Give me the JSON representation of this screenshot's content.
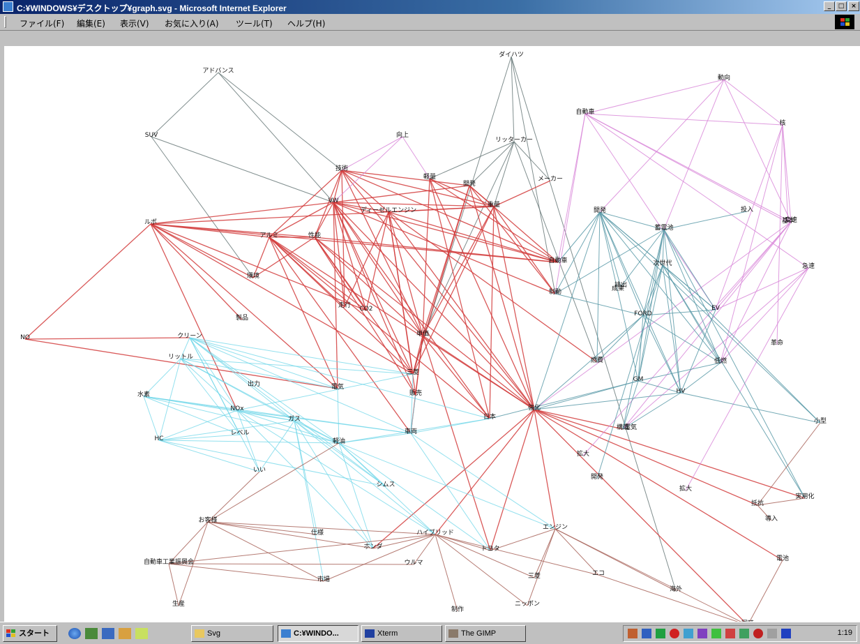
{
  "window": {
    "title": "C:¥WINDOWS¥デスクトップ¥graph.svg - Microsoft Internet Explorer",
    "minimize": "_",
    "maximize": "□",
    "close": "×"
  },
  "menu": [
    "ファイル(F)",
    "編集(E)",
    "表示(V)",
    "お気に入り(A)",
    "ツール(T)",
    "ヘルプ(H)"
  ],
  "graph": {
    "nodes": [
      {
        "id": "daihatsu",
        "label": "ダイハツ"
      },
      {
        "id": "advance",
        "label": "アドバンス"
      },
      {
        "id": "suv",
        "label": "SUV"
      },
      {
        "id": "kouzyou",
        "label": "向上"
      },
      {
        "id": "kakyou",
        "label": "自動車"
      },
      {
        "id": "maker",
        "label": "メーカー"
      },
      {
        "id": "hybrid_top",
        "label": "リッターカー"
      },
      {
        "id": "gijutsu",
        "label": "技術"
      },
      {
        "id": "vw",
        "label": "VW"
      },
      {
        "id": "diesel",
        "label": "ディーゼルエンジン"
      },
      {
        "id": "lupo",
        "label": "ルポ"
      },
      {
        "id": "alumi",
        "label": "アルミ"
      },
      {
        "id": "seinou",
        "label": "性能"
      },
      {
        "id": "keihou",
        "label": "軽量"
      },
      {
        "id": "kaihatsu",
        "label": "開発"
      },
      {
        "id": "juuryou",
        "label": "重量"
      },
      {
        "id": "doukou",
        "label": "動向"
      },
      {
        "id": "co2",
        "label": "CO2"
      },
      {
        "id": "kouden",
        "label": "走行"
      },
      {
        "id": "no",
        "label": "NO"
      },
      {
        "id": "clean",
        "label": "クリーン"
      },
      {
        "id": "liter",
        "label": "リットル"
      },
      {
        "id": "suiso",
        "label": "水素"
      },
      {
        "id": "hc",
        "label": "HC"
      },
      {
        "id": "nox",
        "label": "NOx"
      },
      {
        "id": "level",
        "label": "レベル"
      },
      {
        "id": "gas",
        "label": "ガス"
      },
      {
        "id": "seihin",
        "label": "製品"
      },
      {
        "id": "kankyo",
        "label": "環境"
      },
      {
        "id": "denki",
        "label": "電気"
      },
      {
        "id": "syutsuryoku",
        "label": "出力"
      },
      {
        "id": "ekonomi",
        "label": "エンジン"
      },
      {
        "id": "jidousha2",
        "label": "自動車"
      },
      {
        "id": "toyota",
        "label": "トヨタ"
      },
      {
        "id": "honda",
        "label": "ホンダ"
      },
      {
        "id": "hybrid",
        "label": "ハイブリッド"
      },
      {
        "id": "ikku",
        "label": "いい"
      },
      {
        "id": "shimu",
        "label": "シムス"
      },
      {
        "id": "keiyu",
        "label": "軽油"
      },
      {
        "id": "nenpi",
        "label": "燃費"
      },
      {
        "id": "seidou",
        "label": "制動"
      },
      {
        "id": "ford",
        "label": "FORD"
      },
      {
        "id": "gm",
        "label": "GM"
      },
      {
        "id": "hv",
        "label": "HV"
      },
      {
        "id": "ev",
        "label": "EV"
      },
      {
        "id": "teien",
        "label": "低燃"
      },
      {
        "id": "juuden",
        "label": "蓄電池"
      },
      {
        "id": "sedai",
        "label": "次世代"
      },
      {
        "id": "toukou",
        "label": "投入"
      },
      {
        "id": "kaihen",
        "label": "開発"
      },
      {
        "id": "kaku",
        "label": "核"
      },
      {
        "id": "kakumei",
        "label": "革命"
      },
      {
        "id": "kakudai",
        "label": "拡大"
      },
      {
        "id": "kaihatsu2",
        "label": "開発"
      },
      {
        "id": "kozou",
        "label": "構造"
      },
      {
        "id": "kogata",
        "label": "小型"
      },
      {
        "id": "jitsuyou",
        "label": "実用化"
      },
      {
        "id": "teiko",
        "label": "抵抗"
      },
      {
        "id": "denchi",
        "label": "電池"
      },
      {
        "id": "touki",
        "label": "同時"
      },
      {
        "id": "hensoku",
        "label": "変速"
      },
      {
        "id": "kyuusoku",
        "label": "急速"
      },
      {
        "id": "kihon",
        "label": "基本"
      },
      {
        "id": "haisen",
        "label": "排出"
      },
      {
        "id": "seika",
        "label": "成果"
      },
      {
        "id": "tanka",
        "label": "単価"
      },
      {
        "id": "mitsubishi",
        "label": "三菱"
      },
      {
        "id": "hankou",
        "label": "販売"
      },
      {
        "id": "shaka",
        "label": "車両"
      },
      {
        "id": "nihon",
        "label": "日本"
      },
      {
        "id": "kyouka",
        "label": "強化"
      },
      {
        "id": "ulma",
        "label": "ウルマ"
      },
      {
        "id": "ondensha",
        "label": "お客様"
      },
      {
        "id": "jidouken",
        "label": "自動車工業振興会"
      },
      {
        "id": "hanbai",
        "label": "市場"
      },
      {
        "id": "shiyou",
        "label": "仕様"
      },
      {
        "id": "seisan",
        "label": "生産"
      },
      {
        "id": "boku",
        "label": "拡大"
      },
      {
        "id": "kaigai",
        "label": "海外"
      },
      {
        "id": "sanyou",
        "label": "三菱"
      },
      {
        "id": "eko",
        "label": "エコ"
      },
      {
        "id": "nippon",
        "label": "ニッポン"
      },
      {
        "id": "denkou",
        "label": "電気"
      },
      {
        "id": "touin",
        "label": "導入"
      },
      {
        "id": "seisaku",
        "label": "制作"
      }
    ]
  },
  "taskbar": {
    "start": "スタート",
    "buttons": [
      "Svg",
      "C:¥WINDO...",
      "Xterm",
      "The GIMP"
    ],
    "clock": "1:19"
  },
  "colors": {
    "red_edges": "#d23c3c",
    "cyan_edges": "#6ed6e8",
    "teal_edges": "#5a9aa8",
    "pink_edges": "#d98ad9",
    "brown_edges": "#a8645a",
    "gray_edges": "#6a7a7a"
  }
}
